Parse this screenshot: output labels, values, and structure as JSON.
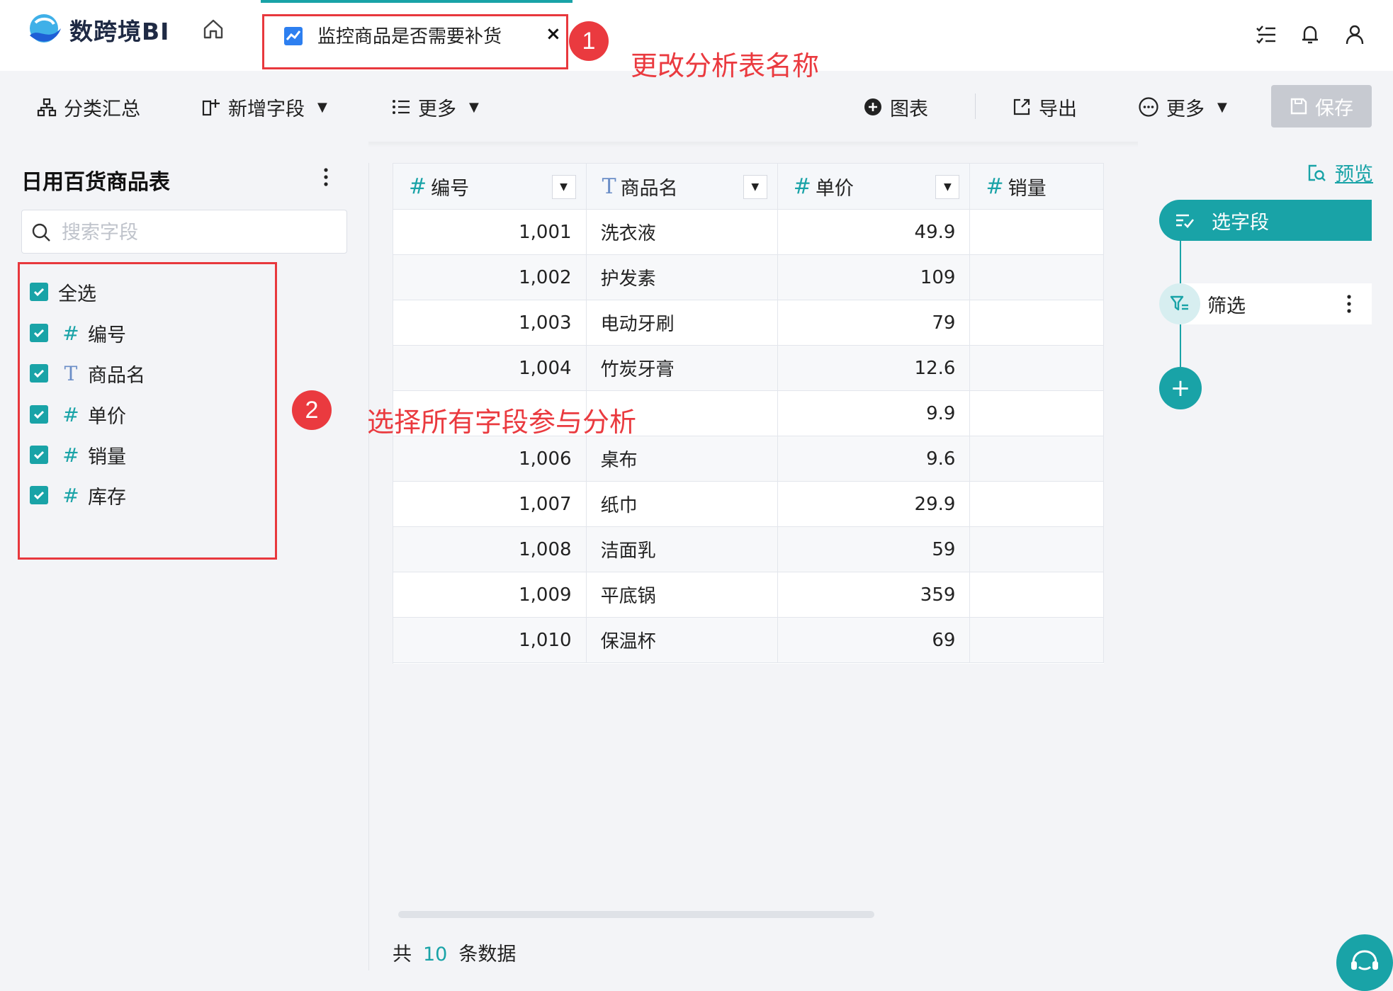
{
  "app": {
    "name": "数跨境BI"
  },
  "tab": {
    "title": "监控商品是否需要补货",
    "close": "×"
  },
  "toolbar": {
    "group_summary": "分类汇总",
    "add_field": "新增字段",
    "more_left": "更多",
    "chart": "图表",
    "export": "导出",
    "more_right": "更多",
    "save": "保存"
  },
  "left_panel": {
    "title": "日用百货商品表",
    "search_placeholder": "搜索字段",
    "select_all": "全选",
    "fields": [
      {
        "type": "#",
        "label": "编号"
      },
      {
        "type": "T",
        "label": "商品名"
      },
      {
        "type": "#",
        "label": "单价"
      },
      {
        "type": "#",
        "label": "销量"
      },
      {
        "type": "#",
        "label": "库存"
      }
    ]
  },
  "table": {
    "columns": [
      {
        "type": "#",
        "label": "编号"
      },
      {
        "type": "T",
        "label": "商品名"
      },
      {
        "type": "#",
        "label": "单价"
      },
      {
        "type": "#",
        "label": "销量"
      }
    ],
    "rows": [
      [
        "1,001",
        "洗衣液",
        "49.9"
      ],
      [
        "1,002",
        "护发素",
        "109"
      ],
      [
        "1,003",
        "电动牙刷",
        "79"
      ],
      [
        "1,004",
        "竹炭牙膏",
        "12.6"
      ],
      [
        "",
        "",
        "9.9"
      ],
      [
        "1,006",
        "桌布",
        "9.6"
      ],
      [
        "1,007",
        "纸巾",
        "29.9"
      ],
      [
        "1,008",
        "洁面乳",
        "59"
      ],
      [
        "1,009",
        "平底锅",
        "359"
      ],
      [
        "1,010",
        "保温杯",
        "69"
      ]
    ]
  },
  "footer": {
    "prefix": "共",
    "count": "10",
    "suffix": "条数据"
  },
  "right_panel": {
    "preview": "预览",
    "step_select": "选字段",
    "step_filter": "筛选",
    "add": "+"
  },
  "annotations": {
    "badge1": "1",
    "text1": "更改分析表名称",
    "badge2": "2",
    "text2": "选择所有字段参与分析"
  },
  "colors": {
    "accent": "#19a3a7",
    "annotation": "#ea3a3f",
    "save_disabled": "#c7cad1"
  }
}
